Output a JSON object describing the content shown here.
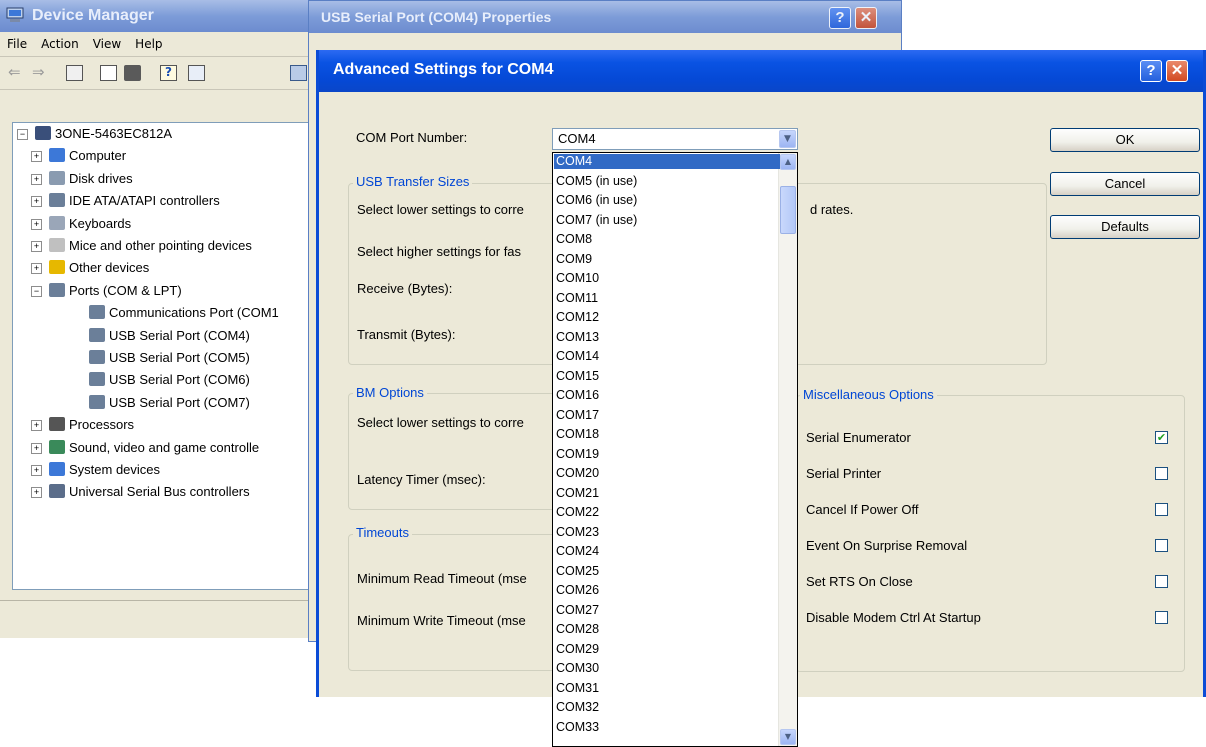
{
  "device_manager": {
    "title": "Device Manager",
    "menu": [
      "File",
      "Action",
      "View",
      "Help"
    ],
    "tree": [
      {
        "label": "3ONE-5463EC812A",
        "level": 0,
        "expander": "−"
      },
      {
        "label": "Computer",
        "level": 1,
        "expander": "+"
      },
      {
        "label": "Disk drives",
        "level": 1,
        "expander": "+"
      },
      {
        "label": "IDE ATA/ATAPI controllers",
        "level": 1,
        "expander": "+"
      },
      {
        "label": "Keyboards",
        "level": 1,
        "expander": "+"
      },
      {
        "label": "Mice and other pointing devices",
        "level": 1,
        "expander": "+"
      },
      {
        "label": "Other devices",
        "level": 1,
        "expander": "+"
      },
      {
        "label": "Ports (COM & LPT)",
        "level": 1,
        "expander": "−"
      },
      {
        "label": "Communications Port (COM1",
        "level": 2,
        "expander": ""
      },
      {
        "label": "USB Serial Port (COM4)",
        "level": 2,
        "expander": ""
      },
      {
        "label": "USB Serial Port (COM5)",
        "level": 2,
        "expander": ""
      },
      {
        "label": "USB Serial Port (COM6)",
        "level": 2,
        "expander": ""
      },
      {
        "label": "USB Serial Port (COM7)",
        "level": 2,
        "expander": ""
      },
      {
        "label": "Processors",
        "level": 1,
        "expander": "+"
      },
      {
        "label": "Sound, video and game controlle",
        "level": 1,
        "expander": "+"
      },
      {
        "label": "System devices",
        "level": 1,
        "expander": "+"
      },
      {
        "label": "Universal Serial Bus controllers",
        "level": 1,
        "expander": "+"
      }
    ]
  },
  "properties": {
    "title": "USB Serial Port (COM4) Properties",
    "help_glyph": "?",
    "close_glyph": "✕"
  },
  "advanced": {
    "title": "Advanced Settings for COM4",
    "help_glyph": "?",
    "close_glyph": "✕",
    "com_port_label": "COM Port Number:",
    "com_port_value": "COM4",
    "usb_group": "USB Transfer Sizes",
    "usb_lower_text": "Select lower settings to corre",
    "usb_lower_tail": "d rates.",
    "usb_higher_text": "Select higher settings for fas",
    "receive_label": "Receive (Bytes):",
    "transmit_label": "Transmit (Bytes):",
    "bm_group": "BM Options",
    "bm_lower_text": "Select lower settings to corre",
    "latency_label": "Latency Timer (msec):",
    "timeouts_group": "Timeouts",
    "min_read_label": "Minimum Read Timeout (mse",
    "min_write_label": "Minimum Write Timeout (mse",
    "misc_group": "Miscellaneous Options",
    "misc_options": [
      {
        "label": "Serial Enumerator",
        "checked": true
      },
      {
        "label": "Serial Printer",
        "checked": false
      },
      {
        "label": "Cancel If Power Off",
        "checked": false
      },
      {
        "label": "Event On Surprise Removal",
        "checked": false
      },
      {
        "label": "Set RTS On Close",
        "checked": false
      },
      {
        "label": "Disable Modem Ctrl At Startup",
        "checked": false
      }
    ],
    "buttons": {
      "ok": "OK",
      "cancel": "Cancel",
      "defaults": "Defaults"
    },
    "check_glyph": "✔",
    "dropdown_options": [
      "COM4",
      "COM5 (in use)",
      "COM6 (in use)",
      "COM7 (in use)",
      "COM8",
      "COM9",
      "COM10",
      "COM11",
      "COM12",
      "COM13",
      "COM14",
      "COM15",
      "COM16",
      "COM17",
      "COM18",
      "COM19",
      "COM20",
      "COM21",
      "COM22",
      "COM23",
      "COM24",
      "COM25",
      "COM26",
      "COM27",
      "COM28",
      "COM29",
      "COM30",
      "COM31",
      "COM32",
      "COM33"
    ],
    "dropdown_selected": "COM4"
  },
  "colors": {
    "title_active": "#0549d6",
    "selection": "#316ac5",
    "group_title": "#0046d5"
  }
}
